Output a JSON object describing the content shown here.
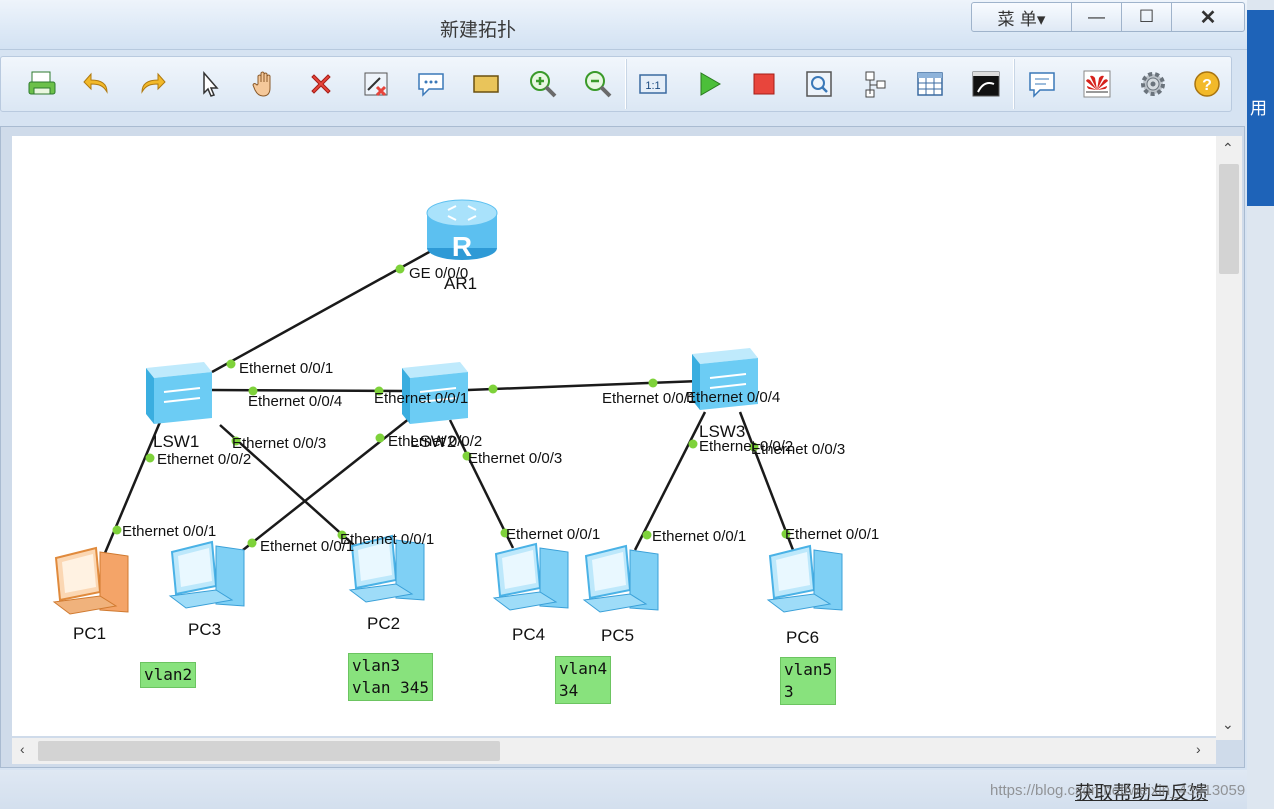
{
  "window": {
    "title": "新建拓扑",
    "menu_label": "菜 单▾",
    "minimize_glyph": "—",
    "maximize_glyph": "☐",
    "close_glyph": "✕"
  },
  "side_window": {
    "text": "用"
  },
  "toolbar": {
    "icons": [
      "print-icon",
      "undo-icon",
      "redo-icon",
      "select-pointer-icon",
      "hand-pan-icon",
      "delete-icon",
      "delete-link-icon",
      "text-annotation-icon",
      "rectangle-icon",
      "zoom-in-icon",
      "zoom-out-icon",
      "fit-icon",
      "start-device-icon",
      "stop-device-icon",
      "capture-data-icon",
      "topology-view-icon",
      "grid-icon",
      "console-icon",
      "message-icon",
      "huawei-icon",
      "settings-icon",
      "help-icon"
    ]
  },
  "topology": {
    "devices": [
      {
        "id": "AR1",
        "label": "AR1",
        "type": "router"
      },
      {
        "id": "LSW1",
        "label": "LSW1",
        "type": "switch"
      },
      {
        "id": "LSW2",
        "label": "LSW2",
        "type": "switch"
      },
      {
        "id": "LSW3",
        "label": "LSW3",
        "type": "switch"
      },
      {
        "id": "PC1",
        "label": "PC1",
        "type": "pc-highlight"
      },
      {
        "id": "PC3",
        "label": "PC3",
        "type": "pc"
      },
      {
        "id": "PC2",
        "label": "PC2",
        "type": "pc"
      },
      {
        "id": "PC4",
        "label": "PC4",
        "type": "pc"
      },
      {
        "id": "PC5",
        "label": "PC5",
        "type": "pc"
      },
      {
        "id": "PC6",
        "label": "PC6",
        "type": "pc"
      }
    ],
    "links": [
      {
        "from": "AR1",
        "to": "LSW1"
      },
      {
        "from": "LSW1",
        "to": "LSW2"
      },
      {
        "from": "LSW2",
        "to": "LSW3"
      },
      {
        "from": "LSW1",
        "to": "PC1"
      },
      {
        "from": "LSW1",
        "to": "PC2"
      },
      {
        "from": "LSW2",
        "to": "PC3"
      },
      {
        "from": "LSW2",
        "to": "PC4"
      },
      {
        "from": "LSW3",
        "to": "PC5"
      },
      {
        "from": "LSW3",
        "to": "PC6"
      }
    ],
    "port_labels": [
      "GE 0/0/0",
      "Ethernet 0/0/1",
      "Ethernet 0/0/4",
      "Ethernet 0/0/1",
      "Ethernet 0/0/3",
      "Ethernet 0/0/2",
      "Ethernet 0/0/2",
      "Ethernet 0/0/3",
      "Ethernet 0/0/1",
      "Ethernet 0/0/4",
      "Ethernet 0/0/2",
      "Ethernet 0/0/3",
      "Ethernet 0/0/1",
      "Ethernet 0/0/1",
      "Ethernet 0/0/1",
      "Ethernet 0/0/1",
      "Ethernet 0/0/1",
      "Ethernet 0/0/1"
    ],
    "notes": [
      {
        "id": "note-vlan2",
        "text": "vlan2"
      },
      {
        "id": "note-vlan3",
        "text": "vlan3\nvlan 345"
      },
      {
        "id": "note-vlan4",
        "text": "vlan4\n34"
      },
      {
        "id": "note-vlan5",
        "text": "vlan5\n3"
      }
    ]
  },
  "status": {
    "help_link": "获取帮助与反馈",
    "watermark": "https://blog.csdn.net/weixin_43913059"
  },
  "colors": {
    "link": "#1a1a1a",
    "port_dot": "#7ed23a",
    "note_bg": "#88e27d",
    "device_blue": "#5fc0f0",
    "pc1_orange": "#f5a86a"
  }
}
